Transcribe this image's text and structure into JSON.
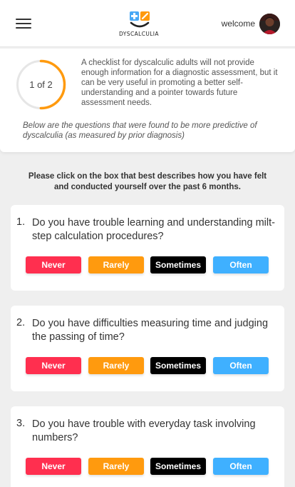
{
  "header": {
    "logo_text": "DYSCALCULIA",
    "welcome_text": "welcome"
  },
  "progress": {
    "label": "1 of 2",
    "fraction": 0.5
  },
  "intro": {
    "text": "A checklist for dyscalculic adults will not provide enough information for a diagnostic assessment, but it can be very useful in promoting a better self-understanding and a pointer towards future assessment needs.",
    "note": "Below are the questions that were found to be more predictive of dyscalculia (as measured by prior diagnosis)"
  },
  "instructions": "Please click on the box that best describes how you have felt and conducted yourself over the past 6 months.",
  "options": {
    "never": "Never",
    "rarely": "Rarely",
    "sometimes": "Sometimes",
    "often": "Often"
  },
  "questions": [
    {
      "number": "1.",
      "text": "Do you have trouble learning and understanding milt-step calculation procedures?"
    },
    {
      "number": "2.",
      "text": "Do you have difficulties measuring time and judging the passing of time?"
    },
    {
      "number": "3.",
      "text": "Do you have trouble with everyday task involving numbers?"
    }
  ],
  "colors": {
    "never": "#ff2f4f",
    "rarely": "#ff9a0e",
    "sometimes": "#000000",
    "often": "#3fb0ff",
    "progress_ring": "#ff9a0e",
    "logo_blue": "#49a8f5",
    "logo_orange": "#ff9a0e"
  }
}
